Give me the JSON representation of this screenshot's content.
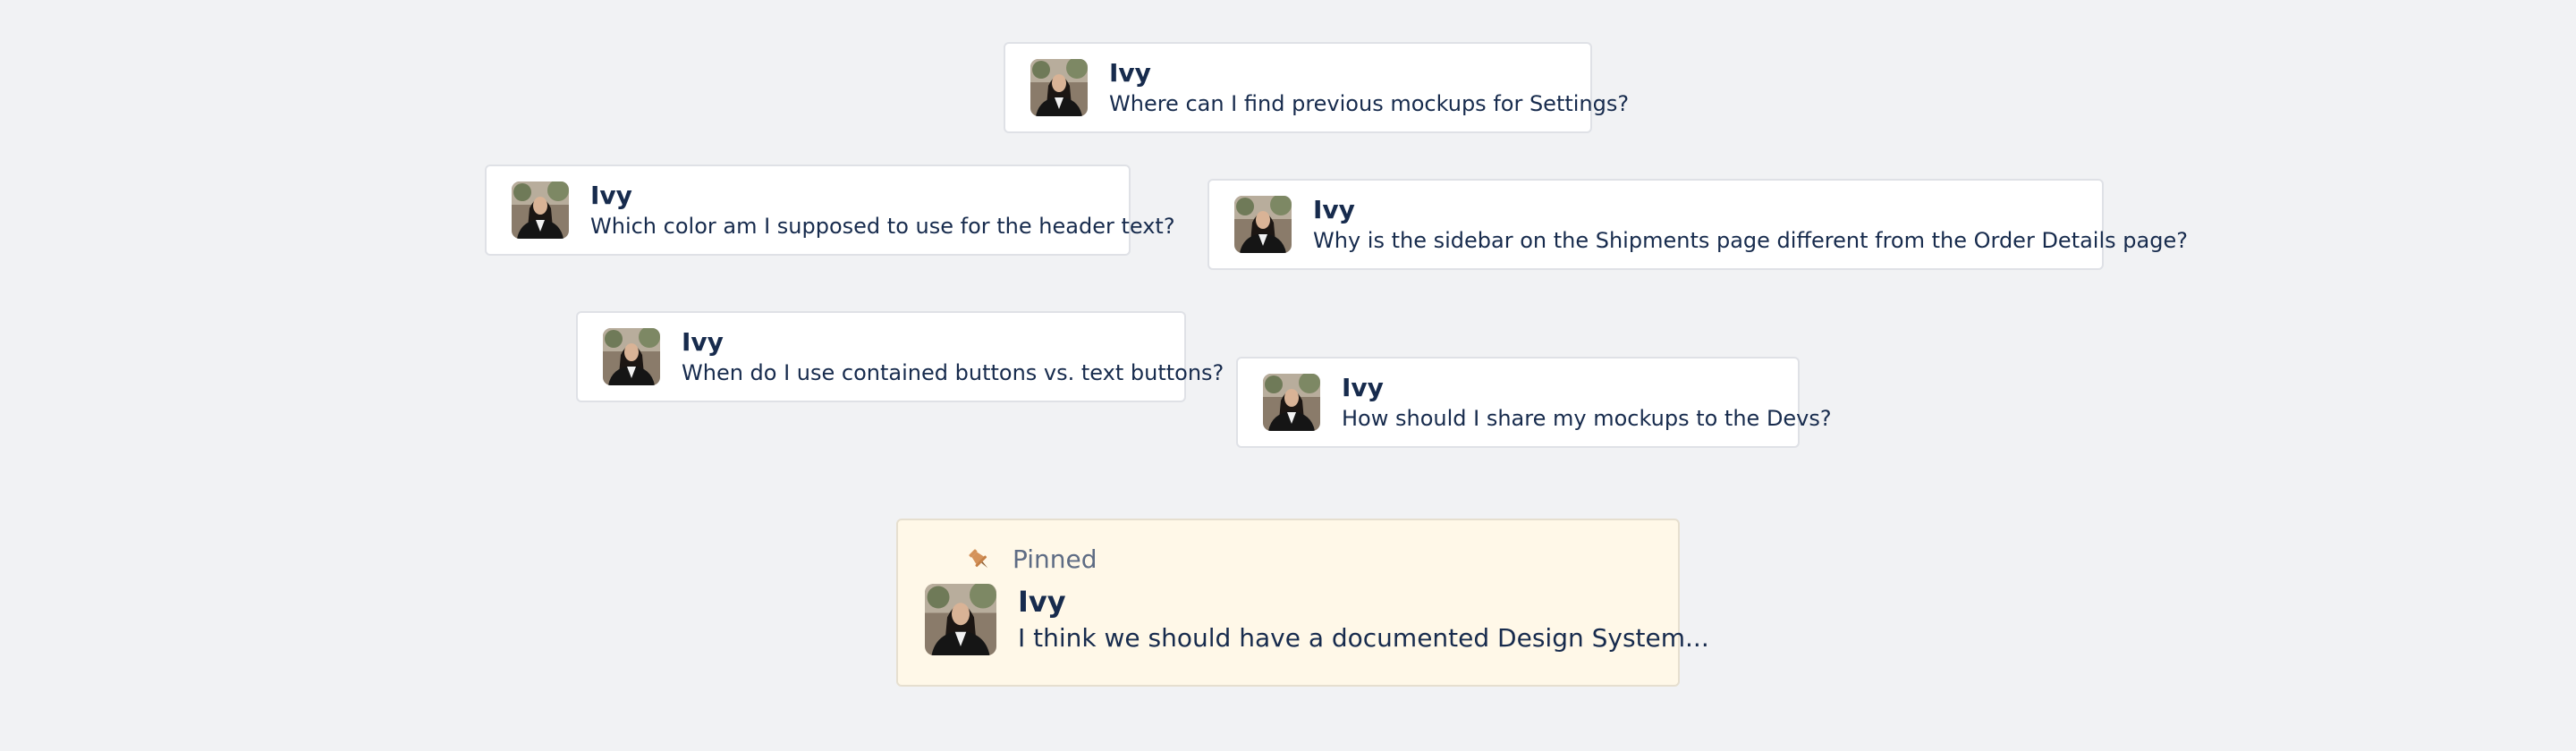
{
  "messages": [
    {
      "author": "Ivy",
      "text": "Where can I find previous mockups for Settings?"
    },
    {
      "author": "Ivy",
      "text": "Which color am I supposed to use for the header text?"
    },
    {
      "author": "Ivy",
      "text": "Why is the sidebar on the Shipments page different from the Order Details page?"
    },
    {
      "author": "Ivy",
      "text": "When do I use contained buttons vs. text buttons?"
    },
    {
      "author": "Ivy",
      "text": "How should I share my mockups to the Devs?"
    }
  ],
  "pinned": {
    "label": "Pinned",
    "icon": "pushpin-icon",
    "author": "Ivy",
    "text": "I think we should have a documented Design System..."
  },
  "colors": {
    "background": "#f1f2f4",
    "card": "#ffffff",
    "pinned_card": "#fff8e8",
    "pin": "#d4925a",
    "text": "#172b4d",
    "muted": "#5e6c84"
  }
}
